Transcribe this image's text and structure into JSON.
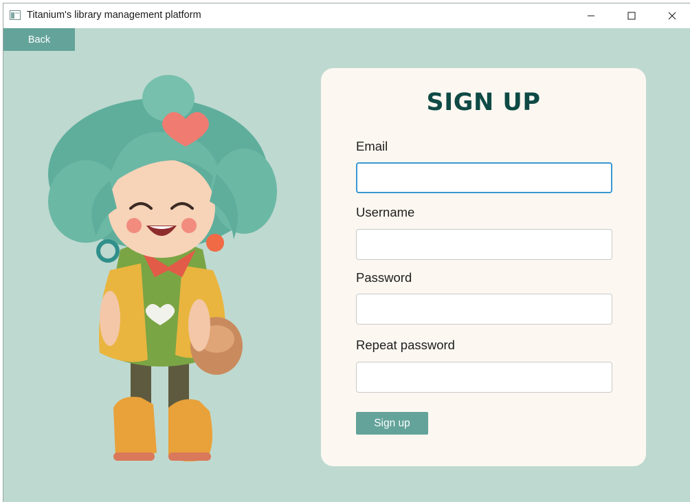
{
  "window": {
    "title": "Titanium's library management platform"
  },
  "nav": {
    "back_label": "Back"
  },
  "form": {
    "heading": "SIGN UP",
    "fields": [
      {
        "label": "Email",
        "value": "",
        "placeholder": ""
      },
      {
        "label": "Username",
        "value": "",
        "placeholder": ""
      },
      {
        "label": "Password",
        "value": "",
        "placeholder": ""
      },
      {
        "label": "Repeat password",
        "value": "",
        "placeholder": ""
      }
    ],
    "submit_label": "Sign up"
  },
  "icons": {
    "app": "app-window-icon",
    "minimize": "minimize-icon",
    "maximize": "maximize-icon",
    "close": "close-icon"
  },
  "colors": {
    "background": "#bed9d0",
    "card": "#fcf8f1",
    "accent": "#63a39a",
    "heading": "#0f4a45",
    "focus_border": "#3b97d3"
  }
}
